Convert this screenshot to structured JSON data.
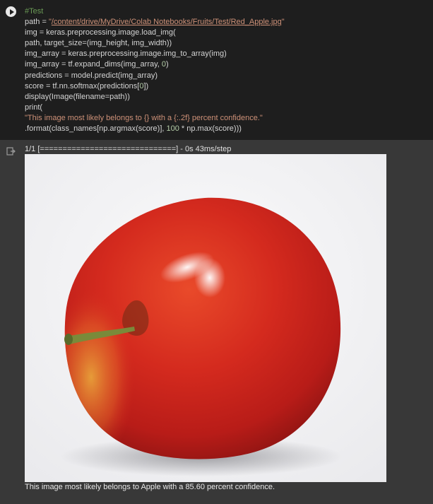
{
  "code_lines": [
    [
      {
        "t": "#Test",
        "c": "c-comment"
      }
    ],
    [
      {
        "t": "path = "
      },
      {
        "t": "\"",
        "c": "c-str"
      },
      {
        "t": "/content/drive/MyDrive/Colab Notebooks/Fruits/Test/Red_Apple.jpg",
        "c": "c-link"
      },
      {
        "t": "\"",
        "c": "c-str"
      }
    ],
    [
      {
        "t": "img = keras.preprocessing.image.load_img("
      }
    ],
    [
      {
        "t": "path, target_size=(img_height, img_width))"
      }
    ],
    [
      {
        "t": "img_array = keras.preprocessing.image.img_to_array(img)"
      }
    ],
    [
      {
        "t": "img_array = tf.expand_dims(img_array, "
      },
      {
        "t": "0",
        "c": "c-num"
      },
      {
        "t": ")"
      }
    ],
    [
      {
        "t": "predictions = model.predict(img_array)"
      }
    ],
    [
      {
        "t": "score = tf.nn.softmax(predictions["
      },
      {
        "t": "0",
        "c": "c-num"
      },
      {
        "t": "])"
      }
    ],
    [
      {
        "t": "display(Image(filename=path))"
      }
    ],
    [
      {
        "t": "print("
      }
    ],
    [
      {
        "t": "\"This image most likely belongs to {} with a {:.2f} percent confidence.\"",
        "c": "c-str"
      }
    ],
    [
      {
        "t": ".format(class_names[np.argmax(score)], "
      },
      {
        "t": "100",
        "c": "c-num"
      },
      {
        "t": " * np.max(score)))"
      }
    ]
  ],
  "output": {
    "progress": "1/1 [==============================] - 0s 43ms/step",
    "result": "This image most likely belongs to Apple with a 85.60 percent confidence."
  },
  "image": {
    "icon": "apple-photo"
  },
  "colors": {
    "cell_bg": "#1e1e1e",
    "output_bg": "#383838",
    "comment": "#6a9955",
    "string": "#ce9178",
    "number": "#b5cea8"
  }
}
